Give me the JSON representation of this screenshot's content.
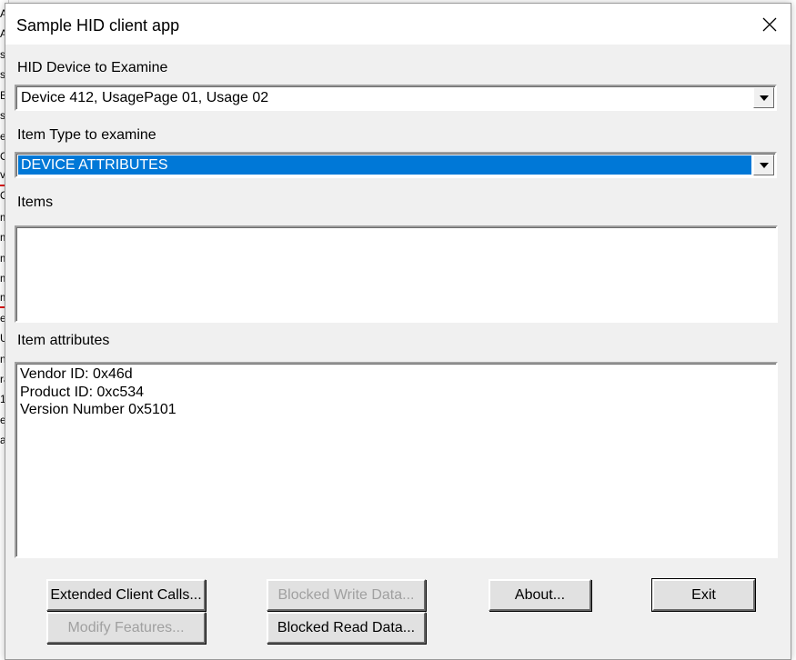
{
  "window": {
    "title": "Sample HID client app"
  },
  "device": {
    "label": "HID Device to Examine",
    "selected": "Device 412, UsagePage 01, Usage 02"
  },
  "item_type": {
    "label": "Item Type to examine",
    "selected": "DEVICE ATTRIBUTES"
  },
  "items": {
    "label": "Items",
    "entries": []
  },
  "item_attributes": {
    "label": "Item attributes",
    "lines": [
      "Vendor ID: 0x46d",
      "Product ID: 0xc534",
      "Version Number  0x5101"
    ]
  },
  "buttons": {
    "extended_client_calls": "Extended Client Calls...",
    "modify_features": "Modify Features...",
    "blocked_write_data": "Blocked Write Data...",
    "blocked_read_data": "Blocked Read Data...",
    "about": "About...",
    "exit": "Exit"
  },
  "colors": {
    "selection": "#0078d7",
    "dialog_bg": "#f0f0f0",
    "disabled_text": "#a0a0a0"
  },
  "background_window": {
    "chars": [
      "A",
      "A",
      "s",
      "s",
      "B",
      "s",
      "e",
      "O",
      "vt",
      "O",
      "m",
      "m",
      "m",
      "m",
      "m",
      "e",
      "U",
      "n",
      "ra",
      "1",
      "ec",
      "a"
    ]
  }
}
